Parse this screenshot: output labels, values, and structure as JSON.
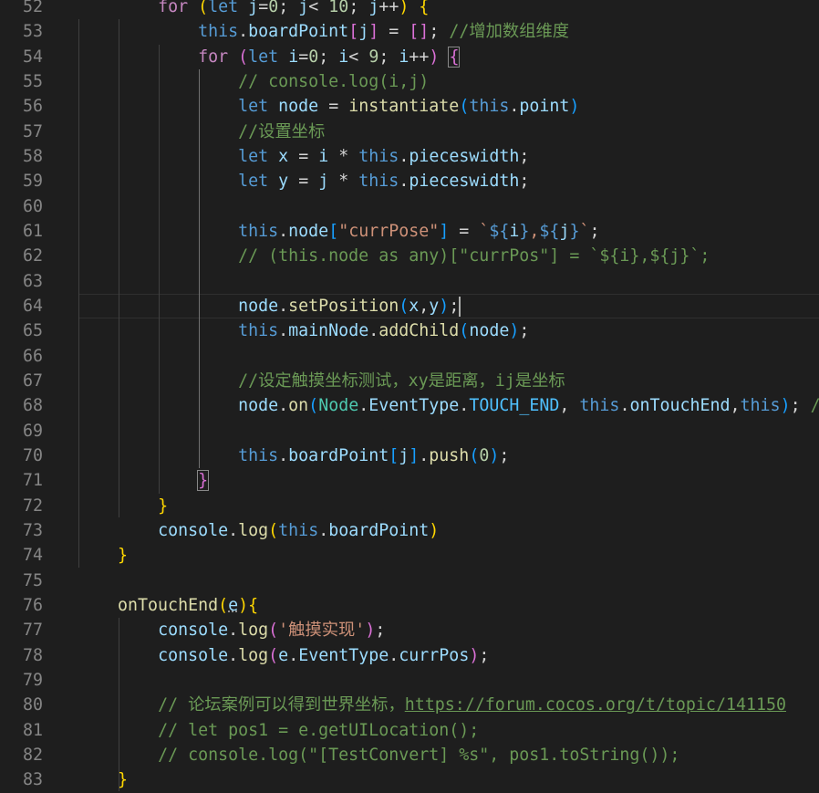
{
  "editor": {
    "language": "TypeScript",
    "theme_colors": {
      "background": "#1e1e1e",
      "line_number": "#858585",
      "keyword": "#569cd6",
      "control": "#c586c0",
      "function": "#dcdcaa",
      "variable": "#9cdcfe",
      "class": "#4ec9b0",
      "number": "#b5cea8",
      "string": "#ce9178",
      "comment": "#6a9955"
    },
    "current_line": 64,
    "lines": [
      {
        "n": "52",
        "text": "        for (let j=0; j< 10; j++) {"
      },
      {
        "n": "53",
        "text": "            this.boardPoint[j] = []; //增加数组维度"
      },
      {
        "n": "54",
        "text": "            for (let i=0; i< 9; i++) {"
      },
      {
        "n": "55",
        "text": "                // console.log(i,j)"
      },
      {
        "n": "56",
        "text": "                let node = instantiate(this.point)"
      },
      {
        "n": "57",
        "text": "                //设置坐标"
      },
      {
        "n": "58",
        "text": "                let x = i * this.pieceswidth;"
      },
      {
        "n": "59",
        "text": "                let y = j * this.pieceswidth;"
      },
      {
        "n": "60",
        "text": ""
      },
      {
        "n": "61",
        "text": "                this.node[\"currPose\"] = `${i},${j}`;"
      },
      {
        "n": "62",
        "text": "                // (this.node as any)[\"currPos\"] = `${i},${j}`;"
      },
      {
        "n": "63",
        "text": ""
      },
      {
        "n": "64",
        "text": "                node.setPosition(x,y);"
      },
      {
        "n": "65",
        "text": "                this.mainNode.addChild(node);"
      },
      {
        "n": "66",
        "text": ""
      },
      {
        "n": "67",
        "text": "                //设定触摸坐标测试，xy是距离，ij是坐标"
      },
      {
        "n": "68",
        "text": "                node.on(Node.EventType.TOUCH_END, this.onTouchEnd,this); //"
      },
      {
        "n": "69",
        "text": ""
      },
      {
        "n": "70",
        "text": "                this.boardPoint[j].push(0);"
      },
      {
        "n": "71",
        "text": "            }"
      },
      {
        "n": "72",
        "text": "        }"
      },
      {
        "n": "73",
        "text": "        console.log(this.boardPoint)"
      },
      {
        "n": "74",
        "text": "    }"
      },
      {
        "n": "75",
        "text": ""
      },
      {
        "n": "76",
        "text": "    onTouchEnd(e){"
      },
      {
        "n": "77",
        "text": "        console.log('触摸实现');"
      },
      {
        "n": "78",
        "text": "        console.log(e.EventType.currPos);"
      },
      {
        "n": "79",
        "text": ""
      },
      {
        "n": "80",
        "text": "        // 论坛案例可以得到世界坐标，https://forum.cocos.org/t/topic/141150"
      },
      {
        "n": "81",
        "text": "        // let pos1 = e.getUILocation();"
      },
      {
        "n": "82",
        "text": "        // console.log(\"[TestConvert] %s\", pos1.toString());"
      },
      {
        "n": "83",
        "text": "    }"
      }
    ]
  }
}
